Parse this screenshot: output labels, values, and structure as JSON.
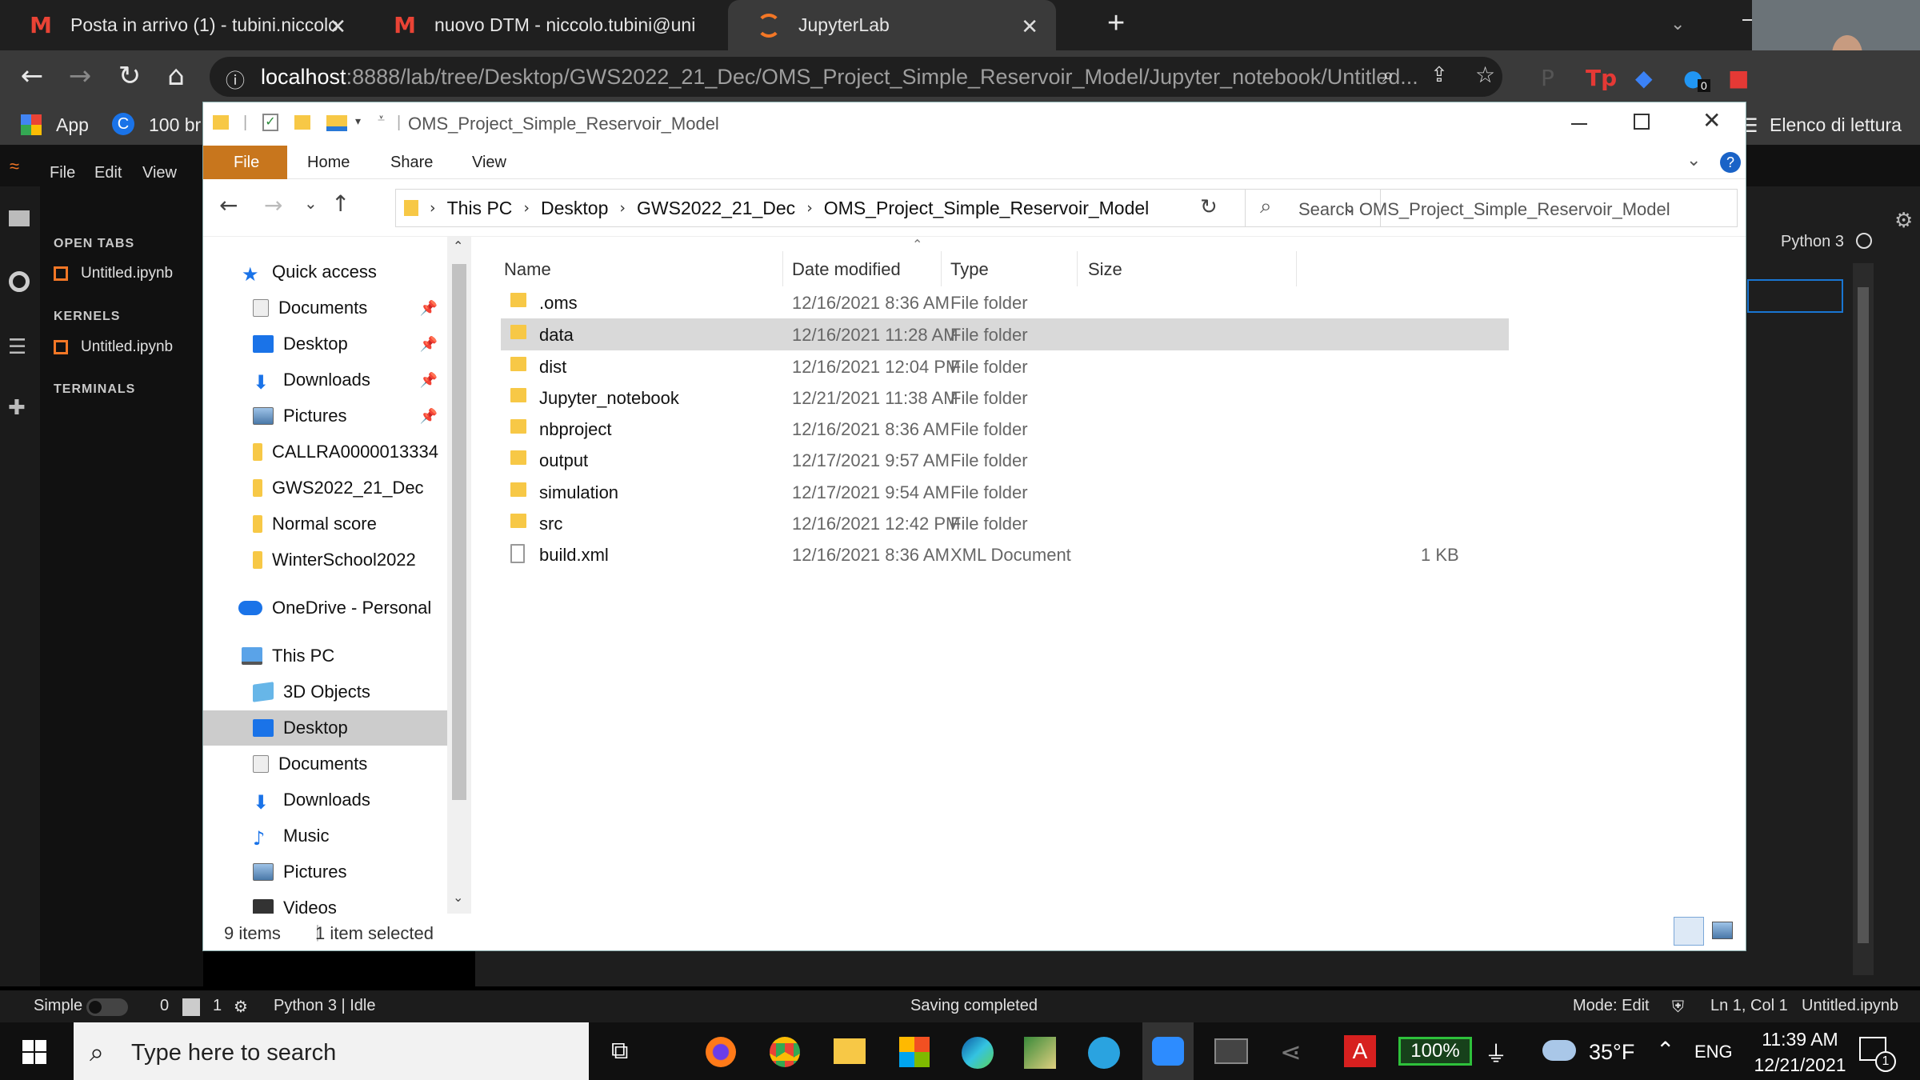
{
  "browser": {
    "tabs": [
      {
        "label": "Posta in arrivo (1) - tubini.niccolo",
        "icon": "gmail-icon"
      },
      {
        "label": "nuovo DTM - niccolo.tubini@uni",
        "icon": "gmail-icon"
      },
      {
        "label": "JupyterLab",
        "icon": "jupyter-icon"
      }
    ],
    "new_tab": "+",
    "url_host": "localhost",
    "url_path": ":8888/lab/tree/Desktop/GWS2022_21_Dec/OMS_Project_Simple_Reservoir_Model/Jupyter_notebook/Untitled...",
    "bookmarks": {
      "apps": "App",
      "second": "100 br",
      "reading_list": "Elenco di lettura"
    },
    "ext_badge": "0"
  },
  "jupyter": {
    "menu": [
      "File",
      "Edit",
      "View"
    ],
    "sections": {
      "open_tabs": "OPEN TABS",
      "kernels": "KERNELS",
      "terminals": "TERMINALS"
    },
    "open_tab_item": "Untitled.ipynb",
    "kernel_item": "Untitled.ipynb",
    "kernel_name": "Python 3",
    "status": {
      "mode_label": "Simple",
      "terminals": "0",
      "kernels": "1",
      "kernel_status": "Python 3 | Idle",
      "message": "Saving completed",
      "mode": "Mode: Edit",
      "position": "Ln 1, Col 1",
      "file": "Untitled.ipynb"
    }
  },
  "explorer": {
    "title": "OMS_Project_Simple_Reservoir_Model",
    "ribbon": [
      "File",
      "Home",
      "Share",
      "View"
    ],
    "breadcrumb": [
      "This PC",
      "Desktop",
      "GWS2022_21_Dec",
      "OMS_Project_Simple_Reservoir_Model"
    ],
    "search_placeholder": "Search OMS_Project_Simple_Reservoir_Model",
    "nav": {
      "quick_access": "Quick access",
      "quick_items": [
        {
          "label": "Documents",
          "pinned": true
        },
        {
          "label": "Desktop",
          "pinned": true
        },
        {
          "label": "Downloads",
          "pinned": true
        },
        {
          "label": "Pictures",
          "pinned": true
        },
        {
          "label": "CALLRA0000013334",
          "pinned": false
        },
        {
          "label": "GWS2022_21_Dec",
          "pinned": false
        },
        {
          "label": "Normal score",
          "pinned": false
        },
        {
          "label": "WinterSchool2022",
          "pinned": false
        }
      ],
      "onedrive": "OneDrive - Personal",
      "this_pc": "This PC",
      "pc_items": [
        "3D Objects",
        "Desktop",
        "Documents",
        "Downloads",
        "Music",
        "Pictures",
        "Videos"
      ]
    },
    "columns": {
      "name": "Name",
      "date": "Date modified",
      "type": "Type",
      "size": "Size"
    },
    "files": [
      {
        "name": ".oms",
        "date": "12/16/2021 8:36 AM",
        "type": "File folder",
        "size": ""
      },
      {
        "name": "data",
        "date": "12/16/2021 11:28 AM",
        "type": "File folder",
        "size": ""
      },
      {
        "name": "dist",
        "date": "12/16/2021 12:04 PM",
        "type": "File folder",
        "size": ""
      },
      {
        "name": "Jupyter_notebook",
        "date": "12/21/2021 11:38 AM",
        "type": "File folder",
        "size": ""
      },
      {
        "name": "nbproject",
        "date": "12/16/2021 8:36 AM",
        "type": "File folder",
        "size": ""
      },
      {
        "name": "output",
        "date": "12/17/2021 9:57 AM",
        "type": "File folder",
        "size": ""
      },
      {
        "name": "simulation",
        "date": "12/17/2021 9:54 AM",
        "type": "File folder",
        "size": ""
      },
      {
        "name": "src",
        "date": "12/16/2021 12:42 PM",
        "type": "File folder",
        "size": ""
      },
      {
        "name": "build.xml",
        "date": "12/16/2021 8:36 AM",
        "type": "XML Document",
        "size": "1 KB"
      }
    ],
    "status": {
      "items": "9 items",
      "selected": "1 item selected"
    }
  },
  "taskbar": {
    "search_placeholder": "Type here to search",
    "battery": "100%",
    "temperature": "35°F",
    "language": "ENG",
    "time": "11:39 AM",
    "date": "12/21/2021",
    "notifications": "1"
  }
}
